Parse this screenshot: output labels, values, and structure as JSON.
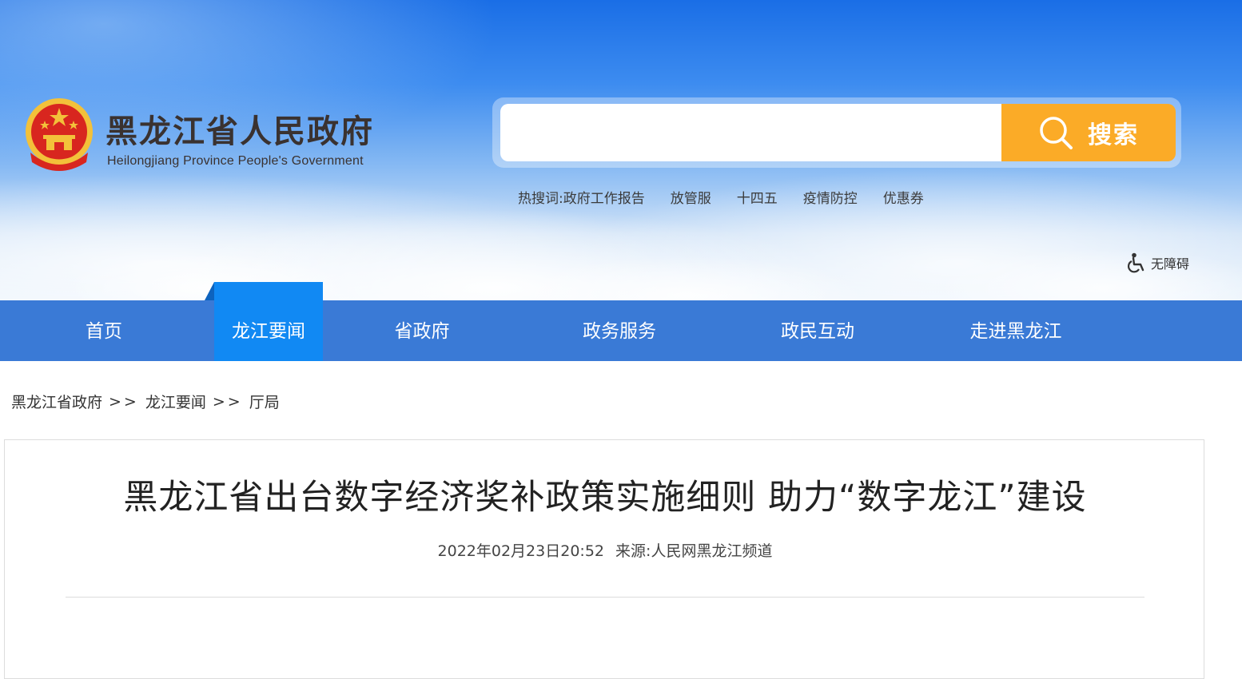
{
  "header": {
    "site_name_cn": "黑龙江省人民政府",
    "site_name_en": "Heilongjiang Province People's Government",
    "emblem_icon": "national-emblem-icon"
  },
  "search": {
    "placeholder": "",
    "button_label": "搜索",
    "hot_label": "热搜词:",
    "hot_keywords": [
      "政府工作报告",
      "放管服",
      "十四五",
      "疫情防控",
      "优惠券"
    ]
  },
  "accessibility": {
    "label": "无障碍",
    "icon": "wheelchair-icon"
  },
  "nav": {
    "items": [
      "首页",
      "龙江要闻",
      "省政府",
      "政务服务",
      "政民互动",
      "走进黑龙江"
    ],
    "active": "龙江要闻"
  },
  "breadcrumb": {
    "items": [
      "黑龙江省政府",
      "龙江要闻",
      "厅局"
    ],
    "separator": ">>"
  },
  "article": {
    "title": "黑龙江省出台数字经济奖补政策实施细则 助力“数字龙江”建设",
    "datetime": "2022年02月23日20:52",
    "source_label": "来源:",
    "source": "人民网黑龙江频道"
  },
  "colors": {
    "nav_bg": "#3a7ad6",
    "nav_active": "#1189f3",
    "search_button": "#fbab27",
    "emblem_red": "#d8261f",
    "emblem_gold": "#f3c13a"
  }
}
